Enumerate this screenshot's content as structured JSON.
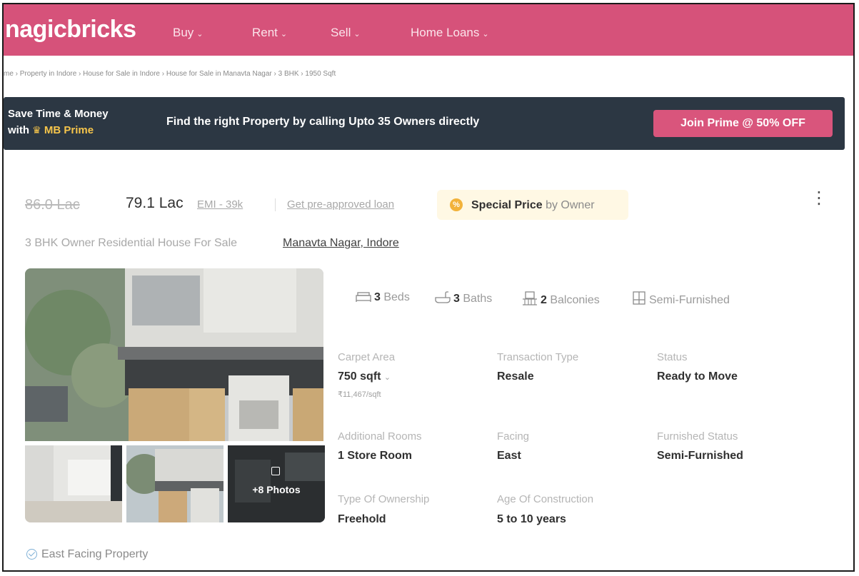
{
  "header": {
    "logo": "nagicbricks",
    "nav": [
      {
        "label": "Buy"
      },
      {
        "label": "Rent"
      },
      {
        "label": "Sell"
      },
      {
        "label": "Home Loans"
      }
    ]
  },
  "breadcrumb": "me › Property in Indore › House for Sale in Indore › House for Sale in Manavta Nagar › 3 BHK › 1950 Sqft",
  "prime": {
    "title_line1": "Save Time & Money",
    "title_line2_prefix": "with",
    "title_line2_brand": "MB Prime",
    "text": "Find the right Property by calling Upto 35 Owners directly",
    "button": "Join Prime @ 50% OFF"
  },
  "listing": {
    "old_price": "86.0 Lac",
    "price": "79.1 Lac",
    "emi": "EMI - 39k",
    "loan_link": "Get pre-approved loan",
    "special_badge_strong": "Special Price",
    "special_badge_suffix": "by Owner",
    "kebab": "⋮",
    "subtitle": "3 BHK Owner Residential House For Sale",
    "locality": "Manavta Nagar, Indore",
    "more_photos": "+8 Photos",
    "amenities": {
      "beds_count": "3",
      "beds_label": "Beds",
      "baths_count": "3",
      "baths_label": "Baths",
      "balconies_count": "2",
      "balconies_label": "Balconies",
      "furnishing": "Semi-Furnished"
    },
    "details": {
      "carpet_area_label": "Carpet Area",
      "carpet_area_value": "750 sqft",
      "price_per_sqft": "₹11,467/sqft",
      "transaction_type_label": "Transaction Type",
      "transaction_type_value": "Resale",
      "status_label": "Status",
      "status_value": "Ready to Move",
      "additional_rooms_label": "Additional Rooms",
      "additional_rooms_value": "1 Store Room",
      "facing_label": "Facing",
      "facing_value": "East",
      "furnished_status_label": "Furnished Status",
      "furnished_status_value": "Semi-Furnished",
      "ownership_label": "Type Of Ownership",
      "ownership_value": "Freehold",
      "age_label": "Age Of Construction",
      "age_value": "5 to 10 years"
    },
    "highlight": "East Facing Property"
  }
}
